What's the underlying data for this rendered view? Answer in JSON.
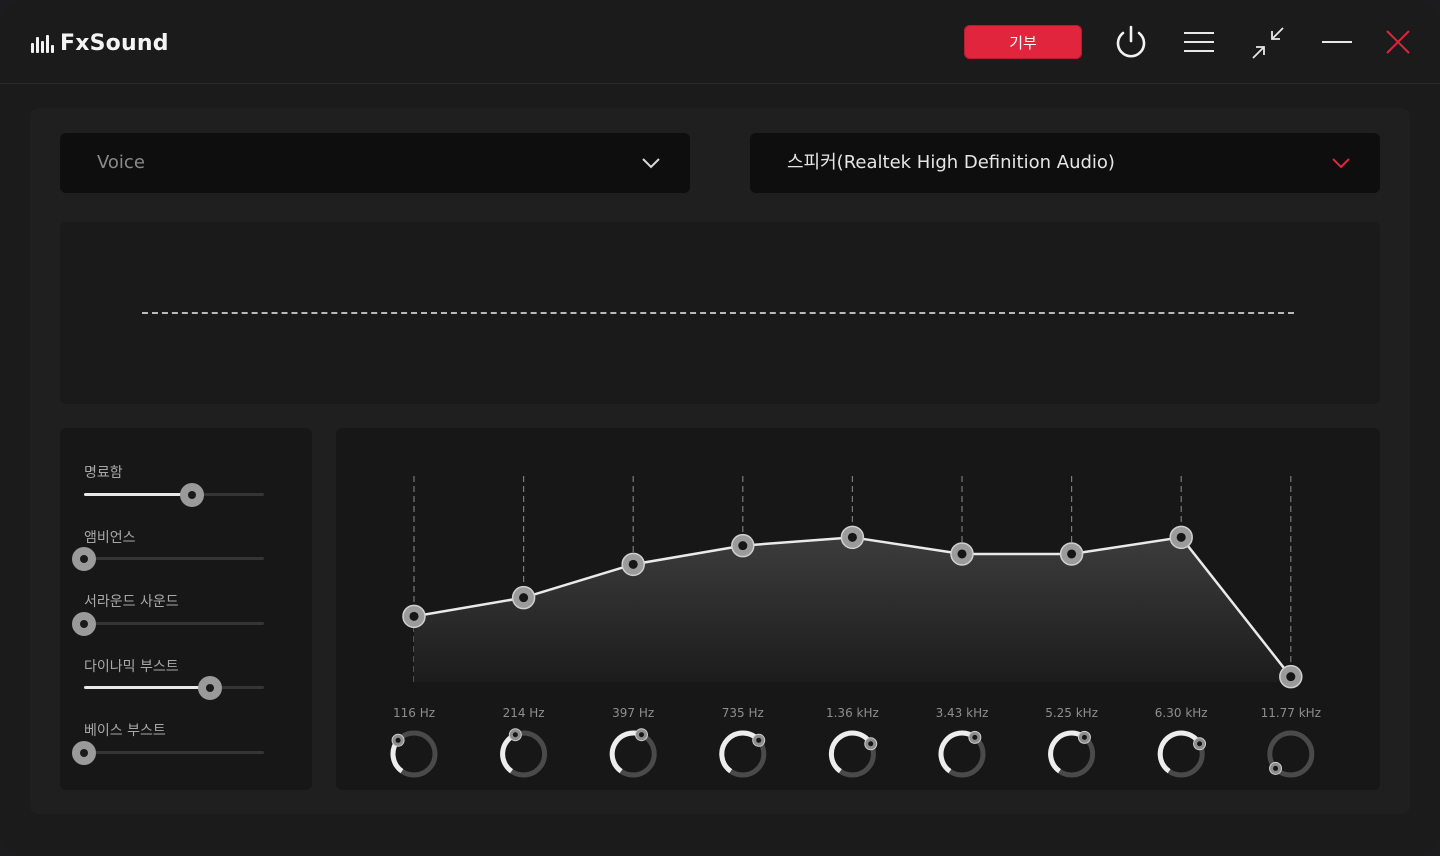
{
  "app": {
    "brand": "FxSound",
    "donate_label": "기부",
    "icons": [
      "power-icon",
      "hamburger-menu-icon",
      "minimize-view-icon",
      "minimize-icon",
      "close-icon"
    ],
    "colors": {
      "accent": "#e0253d",
      "close": "#e0253d",
      "background": "#1b1b1c"
    }
  },
  "preset": {
    "selected": "Voice",
    "icon": "chevron-down-icon"
  },
  "output_device": {
    "selected": "스피커(Realtek High Definition Audio)",
    "icon": "chevron-down-icon"
  },
  "effects": [
    {
      "label": "명료함",
      "value": 0.6
    },
    {
      "label": "앰비언스",
      "value": 0.0
    },
    {
      "label": "서라운드 사운드",
      "value": 0.0
    },
    {
      "label": "다이나믹 부스트",
      "value": 0.7
    },
    {
      "label": "베이스 부스트",
      "value": 0.0
    }
  ],
  "equalizer": {
    "bands": [
      {
        "freq": "116 Hz",
        "gain": 0.33
      },
      {
        "freq": "214 Hz",
        "gain": 0.42
      },
      {
        "freq": "397 Hz",
        "gain": 0.58
      },
      {
        "freq": "735 Hz",
        "gain": 0.67
      },
      {
        "freq": "1.36 kHz",
        "gain": 0.71
      },
      {
        "freq": "3.43 kHz",
        "gain": 0.63
      },
      {
        "freq": "5.25 kHz",
        "gain": 0.63
      },
      {
        "freq": "6.30 kHz",
        "gain": 0.71
      },
      {
        "freq": "11.77 kHz",
        "gain": 0.04
      }
    ]
  }
}
